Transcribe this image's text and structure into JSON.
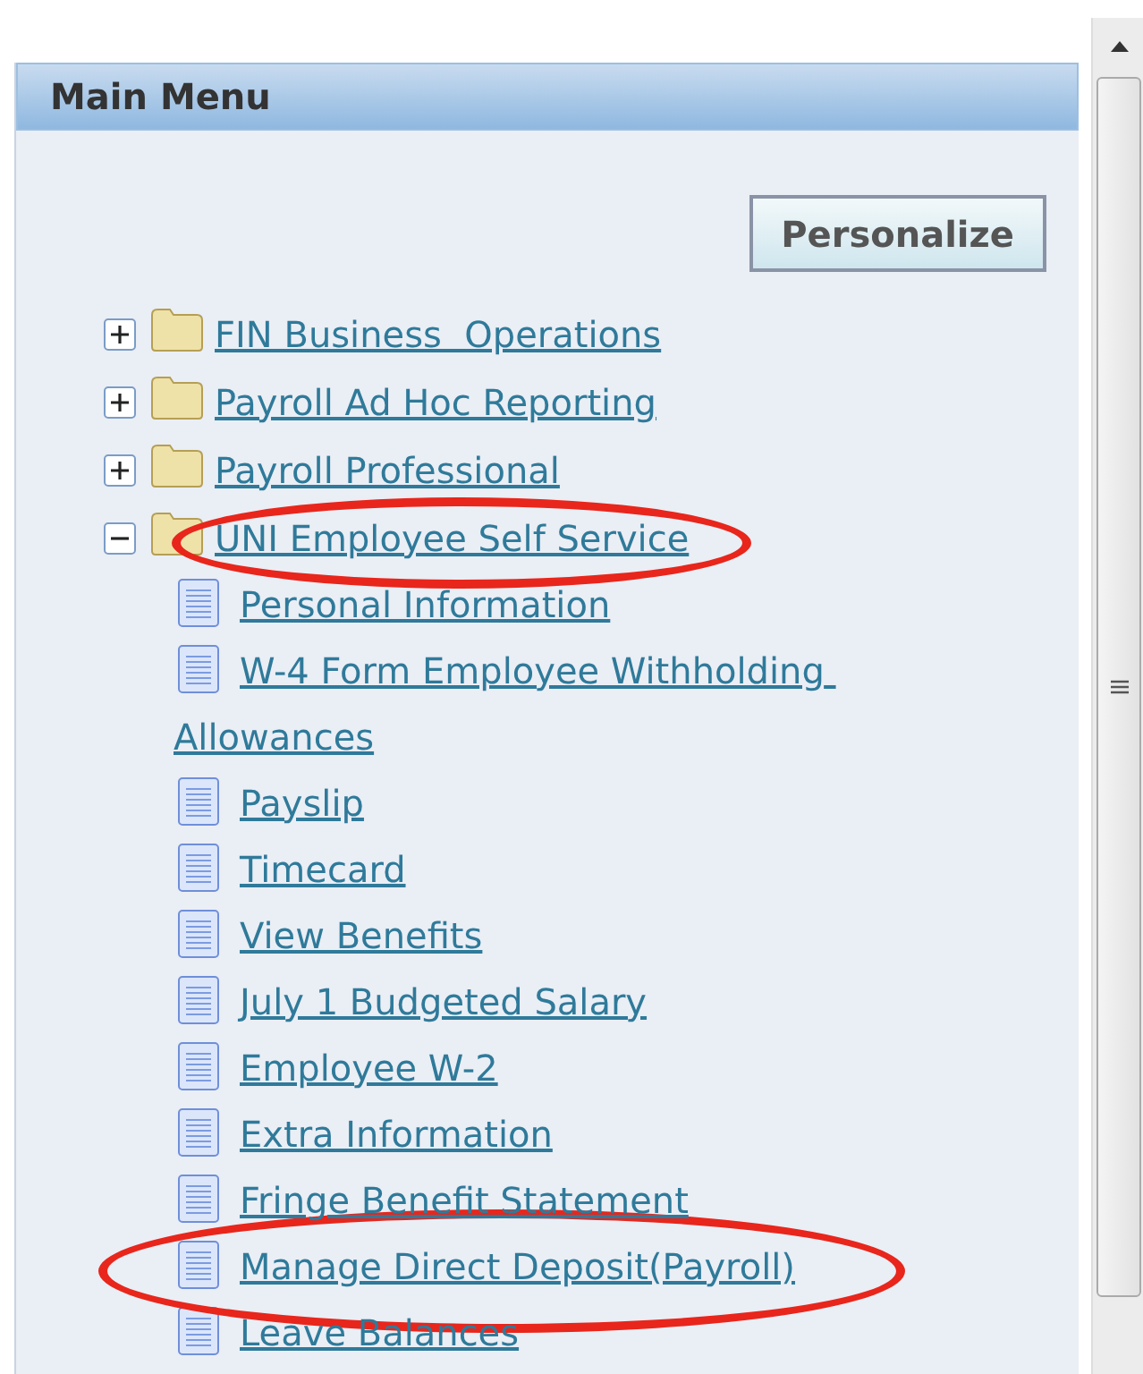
{
  "panel": {
    "title": "Main Menu",
    "button": "Personalize"
  },
  "tree": [
    {
      "label": "FIN Business  Operations",
      "expanded": false,
      "circled": false
    },
    {
      "label": "Payroll Ad Hoc Reporting",
      "expanded": false,
      "circled": false
    },
    {
      "label": "Payroll Professional",
      "expanded": false,
      "circled": false
    },
    {
      "label": "UNI Employee Self Service",
      "expanded": true,
      "circled": true,
      "children": [
        {
          "label": "Personal Information",
          "circled": false
        },
        {
          "label": "W-4 Form Employee Withholding Allowances",
          "circled": false
        },
        {
          "label": "Payslip",
          "circled": false
        },
        {
          "label": "Timecard",
          "circled": false
        },
        {
          "label": "View Benefits",
          "circled": false
        },
        {
          "label": "July 1 Budgeted Salary",
          "circled": false
        },
        {
          "label": "Employee W-2",
          "circled": false
        },
        {
          "label": "Extra Information",
          "circled": false
        },
        {
          "label": "Fringe Benefit Statement",
          "circled": false
        },
        {
          "label": "Manage Direct Deposit(Payroll)",
          "circled": true
        },
        {
          "label": "Leave Balances",
          "circled": false
        }
      ]
    }
  ]
}
